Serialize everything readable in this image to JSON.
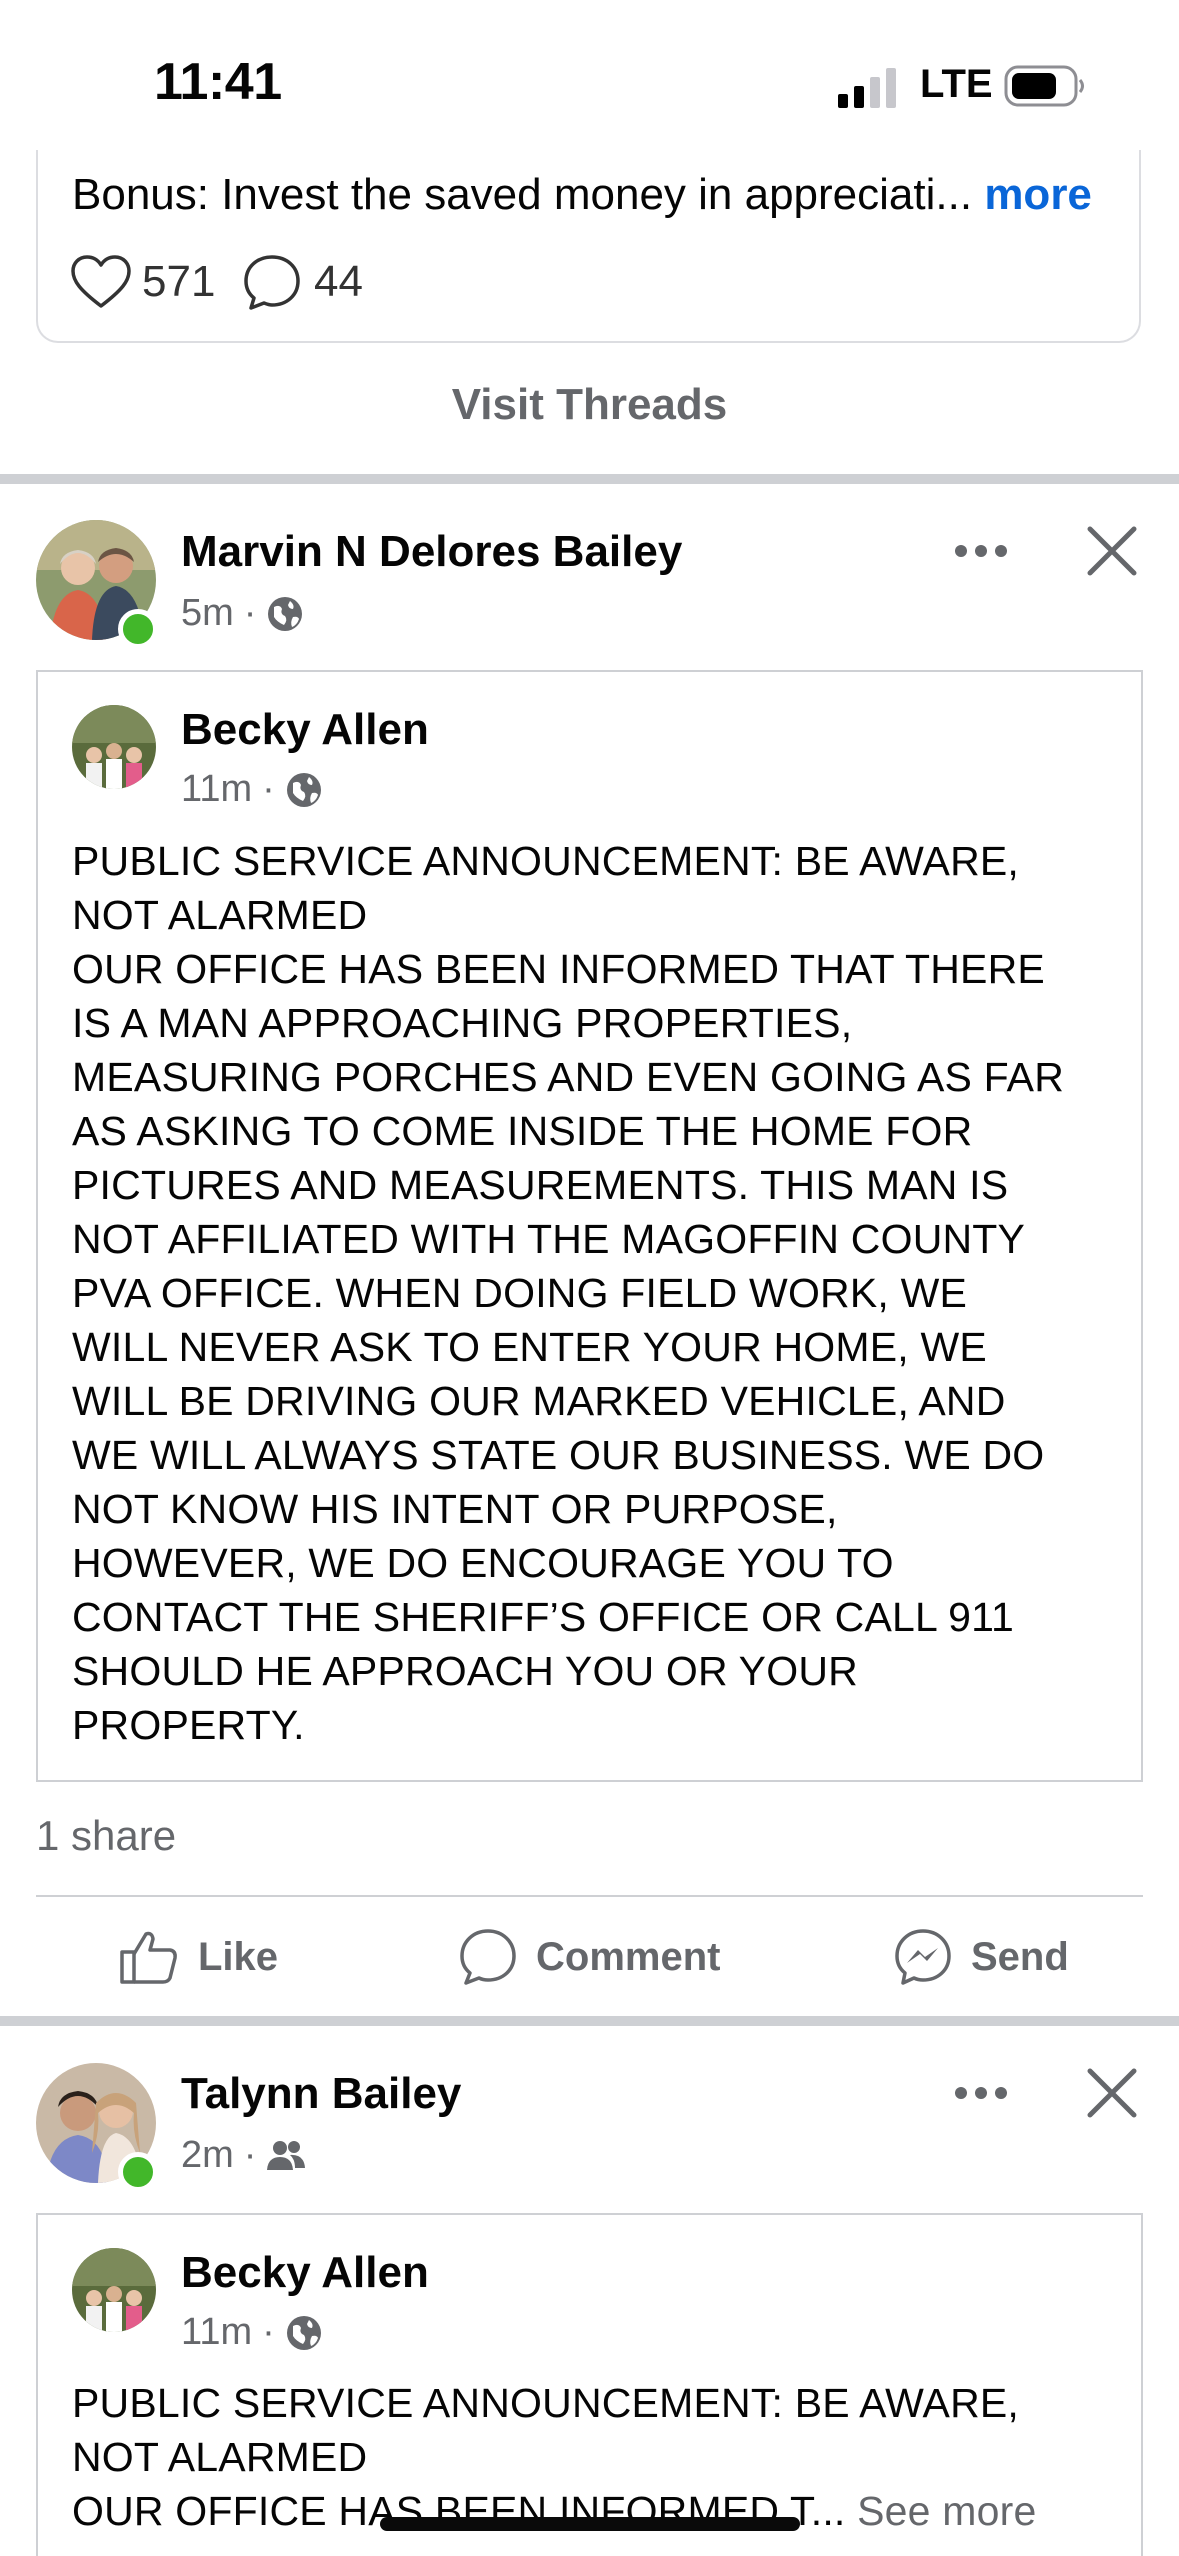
{
  "status_bar": {
    "time": "11:41",
    "network": "LTE"
  },
  "threads_card": {
    "text": "Bonus: Invest the saved money in appreciati...",
    "more_label": "more",
    "likes": "571",
    "comments": "44",
    "visit_label": "Visit Threads"
  },
  "post1": {
    "author": "Marvin N Delores Bailey",
    "time": "5m",
    "audience_icon": "globe-icon",
    "shared": {
      "author": "Becky Allen",
      "time": "11m",
      "audience_icon": "globe-icon",
      "text": "PUBLIC SERVICE ANNOUNCEMENT: BE AWARE,\nNOT ALARMED\nOUR OFFICE HAS BEEN INFORMED THAT THERE\nIS A MAN APPROACHING PROPERTIES,\nMEASURING PORCHES AND EVEN GOING AS FAR\nAS ASKING TO COME INSIDE THE HOME FOR\nPICTURES AND MEASUREMENTS. THIS MAN IS\nNOT AFFILIATED WITH THE MAGOFFIN COUNTY\nPVA OFFICE. WHEN DOING FIELD WORK, WE\nWILL NEVER ASK TO ENTER YOUR HOME, WE\nWILL BE DRIVING OUR MARKED VEHICLE, AND\nWE WILL ALWAYS STATE OUR BUSINESS. WE DO\nNOT KNOW HIS INTENT OR PURPOSE,\nHOWEVER, WE DO ENCOURAGE YOU TO\nCONTACT THE SHERIFF’S OFFICE OR CALL 911\nSHOULD HE APPROACH YOU OR YOUR\nPROPERTY."
    },
    "share_count": "1 share",
    "actions": {
      "like": "Like",
      "comment": "Comment",
      "send": "Send"
    }
  },
  "post2": {
    "author": "Talynn Bailey",
    "time": "2m",
    "audience_icon": "friends-icon",
    "shared": {
      "author": "Becky Allen",
      "time": "11m",
      "audience_icon": "globe-icon",
      "text": "PUBLIC SERVICE ANNOUNCEMENT: BE AWARE,\nNOT ALARMED\nOUR OFFICE HAS BEEN INFORMED T...",
      "see_more": "See more"
    }
  },
  "colors": {
    "link_blue": "#0a66d8",
    "online_green": "#42b72a",
    "muted_text": "#65676b",
    "divider": "#ced0d4"
  }
}
